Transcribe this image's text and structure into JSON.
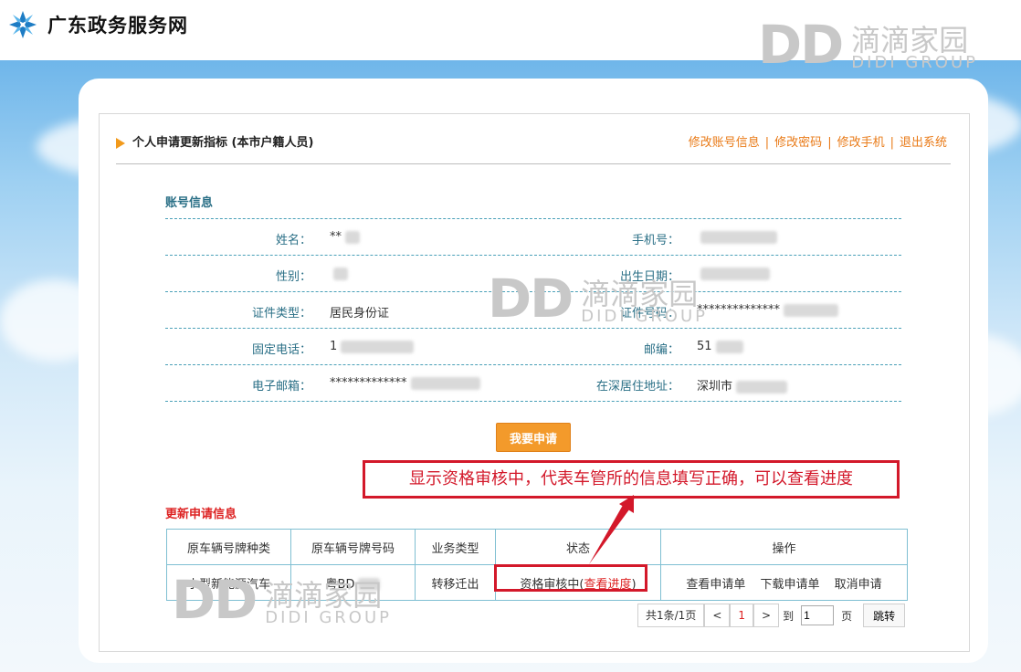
{
  "site": {
    "title": "广东政务服务网"
  },
  "watermark": {
    "dd": "DD",
    "cn": "滴滴家园",
    "en": "DIDI GROUP"
  },
  "header": {
    "section_title": "个人申请更新指标 (本市户籍人员)",
    "links": [
      "修改账号信息",
      "修改密码",
      "修改手机",
      "退出系统"
    ],
    "sep": "|"
  },
  "account": {
    "title": "账号信息",
    "rows": [
      {
        "l_label": "姓名：",
        "l_value": "**",
        "r_label": "手机号：",
        "r_value": ""
      },
      {
        "l_label": "性别：",
        "l_value": "",
        "r_label": "出生日期：",
        "r_value": ""
      },
      {
        "l_label": "证件类型：",
        "l_value": "居民身份证",
        "r_label": "证件号码：",
        "r_value": "**************"
      },
      {
        "l_label": "固定电话：",
        "l_value": "1",
        "r_label": "邮编：",
        "r_value": "51"
      },
      {
        "l_label": "电子邮箱：",
        "l_value": "*************",
        "r_label": "在深居住地址：",
        "r_value": "深圳市"
      }
    ]
  },
  "apply_button": "我要申请",
  "update": {
    "title": "更新申请信息",
    "columns": [
      "原车辆号牌种类",
      "原车辆号牌号码",
      "业务类型",
      "状态",
      "操作"
    ],
    "row": {
      "plate_type": "小型新能源汽车",
      "plate_no": "粤BD",
      "biz_type": "转移迁出",
      "status_prefix": "资格审核中(",
      "status_link": "查看进度",
      "status_suffix": ")",
      "ops": [
        "查看申请单",
        "下载申请单",
        "取消申请"
      ]
    }
  },
  "pager": {
    "summary": "共1条/1页",
    "prev": "<",
    "current": "1",
    "next": ">",
    "to": "到",
    "page_value": "1",
    "page_unit": "页",
    "go": "跳转"
  },
  "annotation": {
    "text": "显示资格审核中，代表车管所的信息填写正确，可以查看进度"
  },
  "colors": {
    "accent": "#e97a17",
    "teal": "#2a6f86",
    "red": "#d3182a",
    "button": "#f39a2b"
  }
}
